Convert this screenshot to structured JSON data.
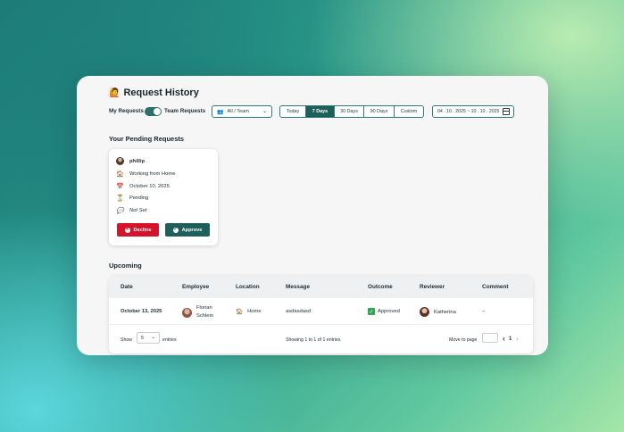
{
  "header": {
    "title_icon": "🙋",
    "title": "Request History"
  },
  "filters": {
    "my_requests_label": "My Requests",
    "team_requests_label": "Team Requests",
    "team_select_value": "All / Team",
    "ranges": [
      "Today",
      "7 Days",
      "30 Days",
      "90 Days",
      "Custom"
    ],
    "active_range": "7 Days",
    "date_range": "04 . 10 . 2025  ~  10 . 10 . 2025"
  },
  "pending": {
    "heading": "Your Pending Requests",
    "name": "phillip",
    "location": "Working from Home",
    "date": "October 10, 2025",
    "status": "Pending",
    "note": "Not Set",
    "decline_label": "Decline",
    "approve_label": "Approve"
  },
  "upcoming": {
    "heading": "Upcoming",
    "columns": [
      "Date",
      "Employee",
      "Location",
      "Message",
      "Outcome",
      "Reviewer",
      "Comment"
    ],
    "rows": [
      {
        "date": "October 13, 2025",
        "employee_first": "Florian",
        "employee_last": "Schlein",
        "location": "Home",
        "message": "asdasdasd",
        "outcome": "Approved",
        "reviewer": "Katherina",
        "comment": "–"
      }
    ],
    "footer": {
      "show_label": "Show",
      "entries_value": "5",
      "entries_label": "entries",
      "showing_text": "Showing 1 to 1 of 1 entries",
      "move_to_page_label": "Move to page",
      "prev_symbol": "‹",
      "current_page": "1",
      "next_symbol": "›"
    }
  },
  "colors": {
    "primary": "#1f5f5b",
    "decline": "#d4142a",
    "approved": "#2fa84f"
  }
}
